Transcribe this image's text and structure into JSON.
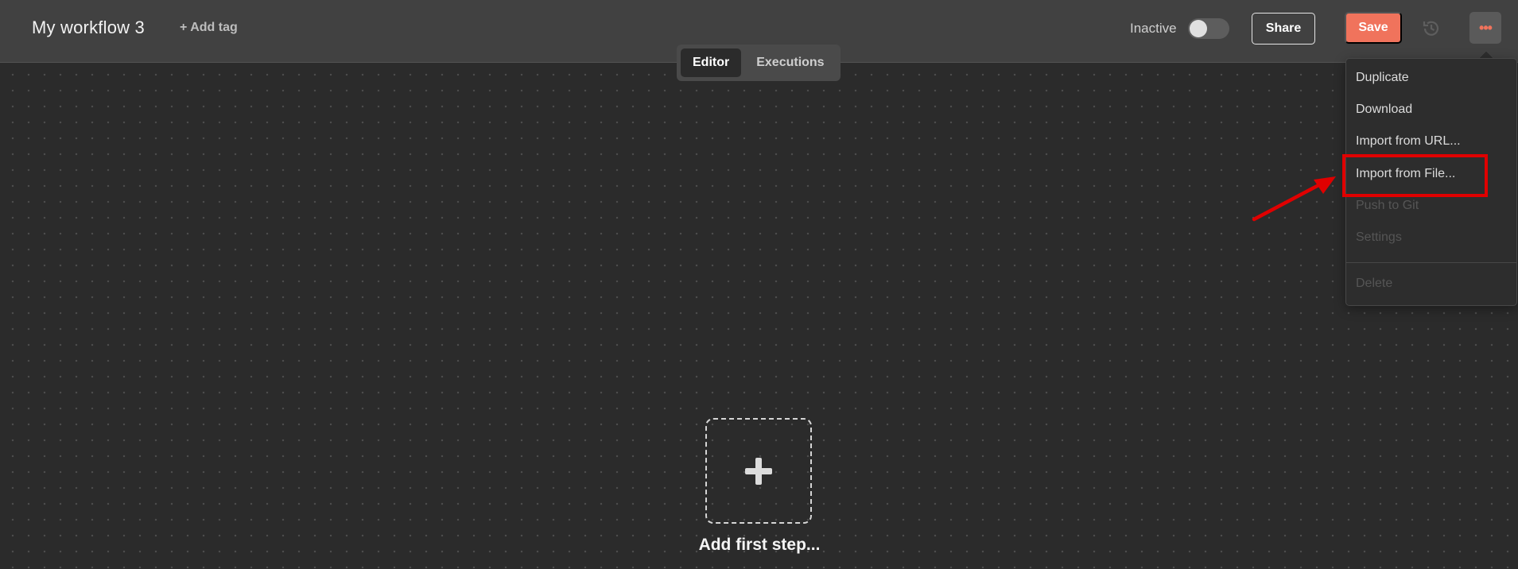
{
  "header": {
    "workflow_title": "My workflow 3",
    "add_tag_label": "+ Add tag",
    "status_label": "Inactive",
    "active": false,
    "share_label": "Share",
    "save_label": "Save",
    "more_label": "•••"
  },
  "tabs": [
    {
      "label": "Editor",
      "active": true
    },
    {
      "label": "Executions",
      "active": false
    }
  ],
  "canvas": {
    "add_step_label": "Add first step..."
  },
  "menu": {
    "items": [
      {
        "label": "Duplicate",
        "enabled": true
      },
      {
        "label": "Download",
        "enabled": true
      },
      {
        "label": "Import from URL...",
        "enabled": true
      },
      {
        "label": "Import from File...",
        "enabled": true,
        "highlighted": true
      },
      {
        "label": "Push to Git",
        "enabled": false
      },
      {
        "label": "Settings",
        "enabled": false
      },
      {
        "label": "Delete",
        "enabled": false
      }
    ]
  },
  "colors": {
    "accent": "#f0735c",
    "highlight": "#e00000",
    "header_bg": "#414141",
    "canvas_bg": "#2b2b2b"
  },
  "icons": {
    "history": "history-icon",
    "more": "more-horizontal-icon",
    "add_step": "plus-icon",
    "annotation_arrow": "arrow-icon"
  }
}
